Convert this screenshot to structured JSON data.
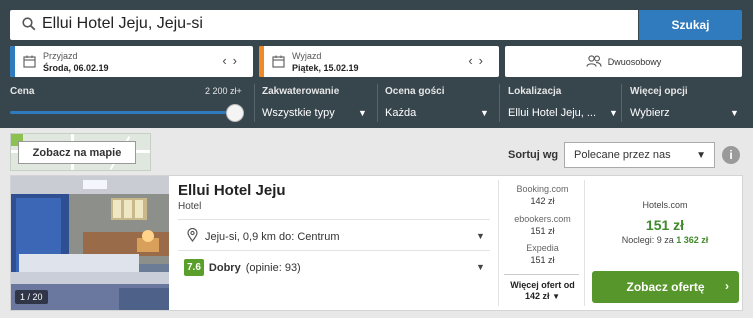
{
  "search": {
    "query": "Ellui Hotel Jeju, Jeju-si",
    "button": "Szukaj"
  },
  "dates": {
    "checkin": {
      "label": "Przyjazd",
      "value": "Środa, 06.02.19",
      "accent": "#2f7bbd"
    },
    "checkout": {
      "label": "Wyjazd",
      "value": "Piątek, 15.02.19",
      "accent": "#f08a24"
    },
    "prev_glyph": "‹",
    "next_glyph": "›"
  },
  "room": {
    "label": "Dwuosobowy",
    "icon": "people-icon"
  },
  "filters": {
    "price": {
      "label": "Cena",
      "max_label": "2 200 zł+",
      "level": 1.0
    },
    "accommodation": {
      "label": "Zakwaterowanie",
      "value": "Wszystkie typy"
    },
    "rating": {
      "label": "Ocena gości",
      "value": "Każda"
    },
    "location": {
      "label": "Lokalizacja",
      "value": "Ellui Hotel Jeju, ..."
    },
    "more": {
      "label": "Więcej opcji",
      "value": "Wybierz"
    }
  },
  "map": {
    "button": "Zobacz na mapie"
  },
  "sort": {
    "label": "Sortuj wg",
    "value": "Polecane przez nas",
    "info": "i"
  },
  "hotel": {
    "name": "Ellui Hotel Jeju",
    "type": "Hotel",
    "photo_counter": "1 / 20",
    "location": "Jeju-si, 0,9 km do: Centrum",
    "rating_score": "7.6",
    "rating_word": "Dobry",
    "rating_count": "(opinie: 93)",
    "offers": [
      {
        "site": "Booking.com",
        "price": "142 zł"
      },
      {
        "site": "ebookers.com",
        "price": "151 zł"
      },
      {
        "site": "Expedia",
        "price": "151 zł"
      }
    ],
    "more_offers_label": "Więcej ofert od",
    "more_offers_price": "142 zł",
    "best": {
      "site": "Hotels.com",
      "price": "151 zł",
      "note_prefix": "Noclegi: 9 za",
      "note_total": "1 362 zł",
      "cta": "Zobacz ofertę"
    }
  },
  "colors": {
    "header_bg": "#37454d",
    "primary_blue": "#2f7bbd",
    "green": "#57962a",
    "orange": "#f08a24"
  }
}
